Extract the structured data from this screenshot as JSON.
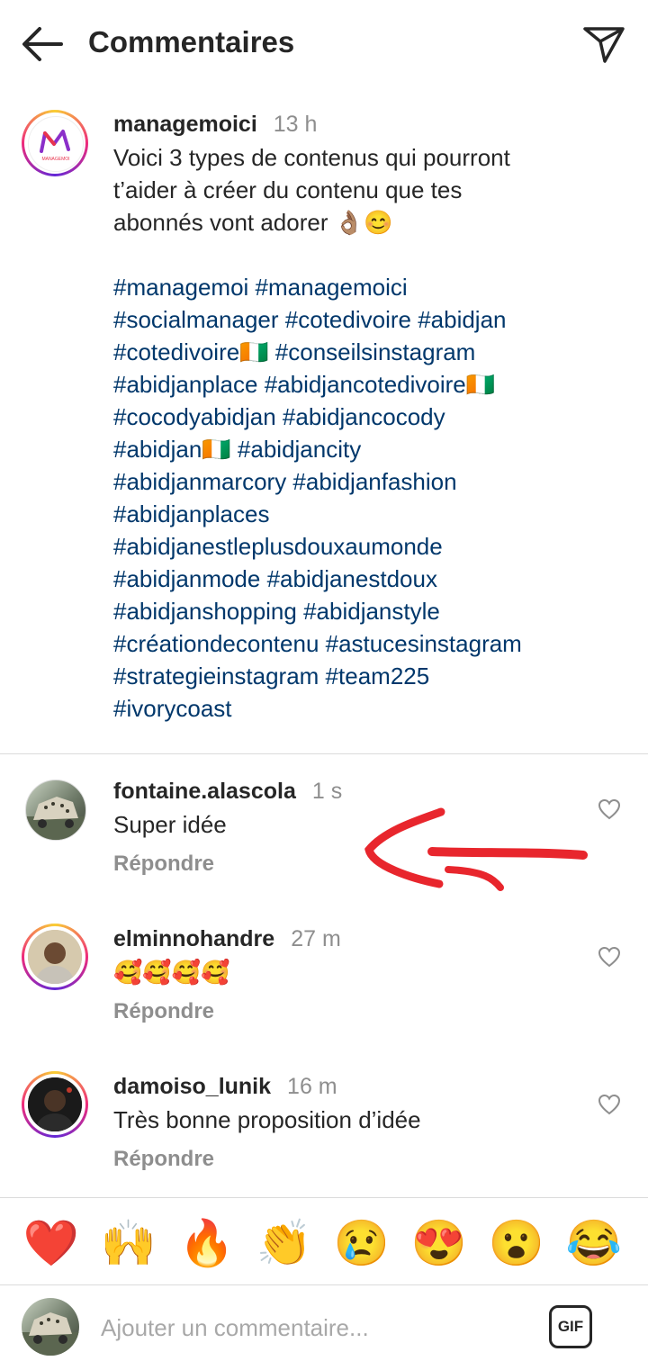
{
  "header": {
    "title": "Commentaires"
  },
  "post": {
    "avatar_text": "MANAGEMOI",
    "username": "managemoici",
    "time": "13 h",
    "text_lines": [
      "Voici 3 types de contenus qui pourront",
      "t’aider à créer du contenu que tes",
      "abonnés vont adorer 👌🏽😊"
    ],
    "hashtag_lines": [
      "#managemoi #managemoici",
      "#socialmanager #cotedivoire #abidjan",
      "#cotedivoire🇨🇮 #conseilsinstagram",
      "#abidjanplace #abidjancotedivoire🇨🇮",
      "#cocodyabidjan #abidjancocody",
      "#abidjan🇨🇮 #abidjancity",
      "#abidjanmarcory #abidjanfashion",
      "#abidjanplaces",
      "#abidjanestleplusdouxaumonde",
      "#abidjanmode #abidjanestdoux",
      "#abidjanshopping #abidjanstyle",
      "#créationdecontenu #astucesinstagram",
      "#strategieinstagram #team225",
      "#ivorycoast"
    ]
  },
  "comments": [
    {
      "username": "fontaine.alascola",
      "time": "1 s",
      "text": "Super idée",
      "reply": "Répondre"
    },
    {
      "username": "elminnohandre",
      "time": "27 m",
      "text": "🥰🥰🥰🥰",
      "reply": "Répondre"
    },
    {
      "username": "damoiso_lunik",
      "time": "16 m",
      "text": "Très bonne proposition d’idée",
      "reply": "Répondre"
    }
  ],
  "emoji_bar": [
    "❤️",
    "🙌",
    "🔥",
    "👏",
    "😢",
    "😍",
    "😮",
    "😂"
  ],
  "compose": {
    "placeholder": "Ajouter un commentaire...",
    "gif_label": "GIF"
  },
  "colors": {
    "hashtag": "#00376b",
    "muted": "#8e8e8e",
    "annotation_arrow": "#e8262d"
  }
}
